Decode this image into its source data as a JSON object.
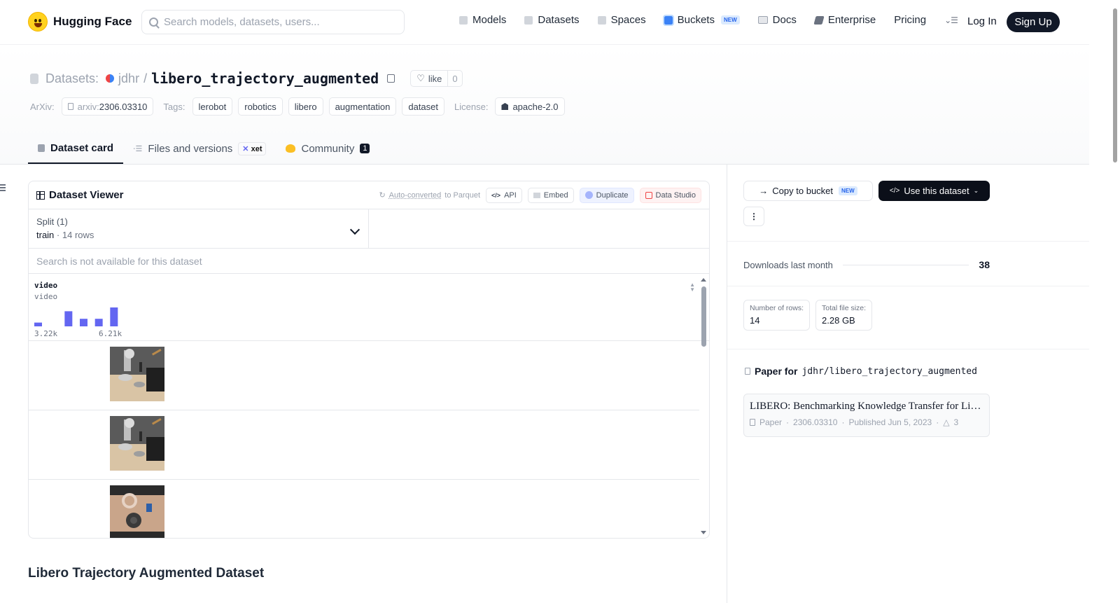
{
  "header": {
    "brand": "Hugging Face",
    "search_placeholder": "Search models, datasets, users...",
    "nav": [
      {
        "label": "Models",
        "icon": "cube-icon"
      },
      {
        "label": "Datasets",
        "icon": "database-icon"
      },
      {
        "label": "Spaces",
        "icon": "grid-icon"
      },
      {
        "label": "Buckets",
        "icon": "bucket-icon",
        "badge": "NEW"
      },
      {
        "label": "Docs",
        "icon": "book-icon"
      },
      {
        "label": "Enterprise",
        "icon": "enterprise-icon"
      },
      {
        "label": "Pricing"
      }
    ],
    "login": "Log In",
    "signup": "Sign Up"
  },
  "repo": {
    "kind": "Datasets:",
    "owner": "jdhr",
    "name": "libero_trajectory_augmented",
    "like_label": "like",
    "like_count": "0",
    "arxiv_label": "ArXiv:",
    "arxiv_prefix": "arxiv:",
    "arxiv_id": "2306.03310",
    "tags_label": "Tags:",
    "tags": [
      "lerobot",
      "robotics",
      "libero",
      "augmentation",
      "dataset"
    ],
    "license_label": "License:",
    "license": "apache-2.0"
  },
  "tabs": {
    "card": "Dataset card",
    "files": "Files and versions",
    "xet": "xet",
    "community": "Community",
    "community_count": "1"
  },
  "viewer": {
    "title": "Dataset Viewer",
    "auto": "Auto-converted",
    "auto_suffix": "to Parquet",
    "api": "API",
    "embed": "Embed",
    "duplicate": "Duplicate",
    "data_studio": "Data Studio",
    "split_label": "Split (1)",
    "split_value": "train",
    "split_rows": "14 rows",
    "search_na": "Search is not available for this dataset",
    "column_name": "video",
    "column_type": "video",
    "histogram": {
      "min_label": "3.22k",
      "max_label": "6.21k",
      "bins": [
        0.2,
        0,
        0.8,
        0.4,
        0.4,
        1.0
      ]
    }
  },
  "readme_title": "Libero Trajectory Augmented Dataset",
  "sidebar": {
    "copy_bucket": "Copy to bucket",
    "copy_badge": "NEW",
    "use_dataset": "Use this dataset",
    "downloads_label": "Downloads last month",
    "downloads": "38",
    "rows_label": "Number of rows:",
    "rows": "14",
    "size_label": "Total file size:",
    "size": "2.28 GB",
    "paper_for": "Paper for",
    "paper_repo": "jdhr/libero_trajectory_augmented",
    "paper_title": "LIBERO: Benchmarking Knowledge Transfer for Lifelong Robot Learning",
    "paper_kind": "Paper",
    "paper_id": "2306.03310",
    "paper_date": "Published Jun 5, 2023",
    "paper_upvotes": "3"
  },
  "colors": {
    "accent": "#6366f1",
    "dark": "#0b0f19",
    "border": "#e5e7eb"
  }
}
